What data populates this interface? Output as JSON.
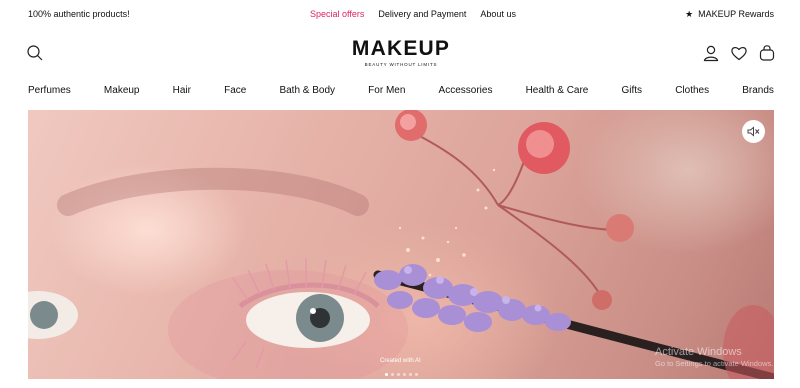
{
  "topbar": {
    "authentic": "100% authentic products!",
    "links": [
      "Special offers",
      "Delivery and Payment",
      "About us"
    ],
    "rewards": "MAKEUP Rewards",
    "promo_color": "#e0245e"
  },
  "header": {
    "logo": "MAKEUP",
    "tagline": "BEAUTY WITHOUT LIMITS",
    "icons": [
      "search-icon",
      "account-icon",
      "heart-icon",
      "bag-icon"
    ]
  },
  "nav": {
    "items": [
      "Perfumes",
      "Makeup",
      "Hair",
      "Face",
      "Bath & Body",
      "For Men",
      "Accessories",
      "Health & Care",
      "Gifts",
      "Clothes",
      "Brands"
    ]
  },
  "hero": {
    "caption": "Created with AI",
    "mute_icon": "speaker-muted-icon",
    "slides_count": 6,
    "active_slide": 1
  },
  "watermark": {
    "line1": "Activate Windows",
    "line2": "Go to Settings to activate Windows."
  }
}
